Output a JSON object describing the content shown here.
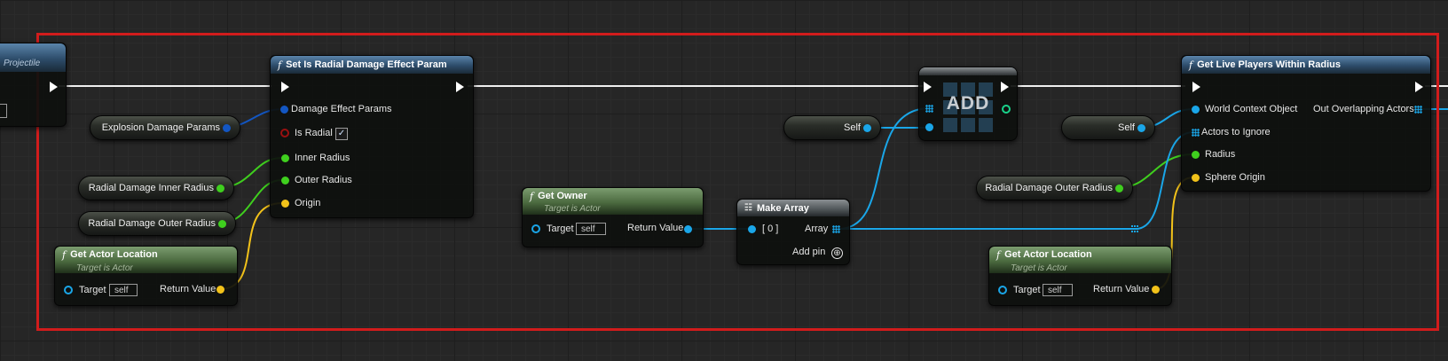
{
  "graph": {
    "nodes": {
      "projectile": {
        "subtitle": "Projectile"
      },
      "set_radial": {
        "title": "Set Is Radial Damage Effect Param",
        "pins": {
          "damage_effect_params": "Damage Effect Params",
          "is_radial": "Is Radial",
          "is_radial_checked": "✓",
          "inner_radius": "Inner Radius",
          "outer_radius": "Outer Radius",
          "origin": "Origin"
        }
      },
      "explosion_damage_params": {
        "label": "Explosion Damage Params"
      },
      "radial_inner": {
        "label": "Radial Damage Inner Radius"
      },
      "radial_outer_left": {
        "label": "Radial Damage Outer Radius"
      },
      "get_actor_location_left": {
        "title": "Get Actor Location",
        "subtitle": "Target is Actor",
        "target_label": "Target",
        "target_value": "self",
        "return_label": "Return Value"
      },
      "get_owner": {
        "title": "Get Owner",
        "subtitle": "Target is Actor",
        "target_label": "Target",
        "target_value": "self",
        "return_label": "Return Value"
      },
      "make_array": {
        "title": "Make Array",
        "index_label": "[ 0 ]",
        "array_label": "Array",
        "add_pin_label": "Add pin",
        "add_pin_icon": "⊕"
      },
      "self_mid": {
        "label": "Self"
      },
      "add": {
        "label": "ADD"
      },
      "self_right": {
        "label": "Self"
      },
      "radial_outer_right": {
        "label": "Radial Damage Outer Radius"
      },
      "get_actor_location_right": {
        "title": "Get Actor Location",
        "subtitle": "Target is Actor",
        "target_label": "Target",
        "target_value": "self",
        "return_label": "Return Value"
      },
      "get_live_players": {
        "title": "Get Live Players Within Radius",
        "pins": {
          "world_context": "World Context Object",
          "out_overlapping": "Out Overlapping Actors",
          "actors_to_ignore": "Actors to Ignore",
          "radius": "Radius",
          "sphere_origin": "Sphere Origin"
        }
      }
    },
    "icons": {
      "function": "function-icon",
      "make_array": "make-array-icon",
      "exec": "exec-pin-icon",
      "add_pin": "add-pin-icon"
    },
    "colors": {
      "comment_border": "#d11c1c",
      "exec_wire": "#ffffff",
      "object_pin": "#1aa6e8",
      "struct_pin": "#1356c2",
      "float_pin": "#3fcf1e",
      "vector_pin": "#f2c21a",
      "bool_pin": "#9a1010"
    }
  }
}
